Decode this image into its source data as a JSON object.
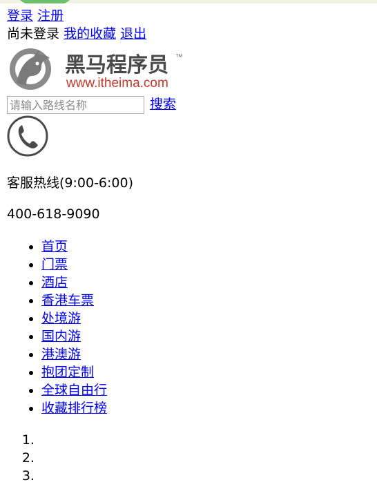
{
  "header": {
    "login_link": "登录",
    "register_link": "注册",
    "status_text": "尚未登录",
    "favorites_link": "我的收藏",
    "logout_link": "退出"
  },
  "logo": {
    "brand_name": "黑马程序员",
    "trademark": "™",
    "url_text": "www.itheima.com",
    "colors": {
      "gray": "#7a7a7a",
      "red": "#c0392b",
      "dark": "#4a4a4a"
    }
  },
  "search": {
    "placeholder": "请输入路线名称",
    "value": "",
    "button_label": "搜索"
  },
  "hotline": {
    "icon": "phone-icon",
    "label": "客服热线(9:00-6:00)",
    "number": "400-618-9090"
  },
  "nav": {
    "items": [
      {
        "label": "首页"
      },
      {
        "label": "门票"
      },
      {
        "label": "酒店"
      },
      {
        "label": "香港车票"
      },
      {
        "label": "处境游"
      },
      {
        "label": "国内游"
      },
      {
        "label": "港澳游"
      },
      {
        "label": "抱团定制"
      },
      {
        "label": "全球自由行"
      },
      {
        "label": "收藏排行榜"
      }
    ]
  },
  "ranked_list": {
    "items": [
      "",
      "",
      ""
    ]
  },
  "colors": {
    "link": "#0000ee",
    "top_strip": "#f3f0e6",
    "top_strip_accent": "#6cc06d"
  }
}
